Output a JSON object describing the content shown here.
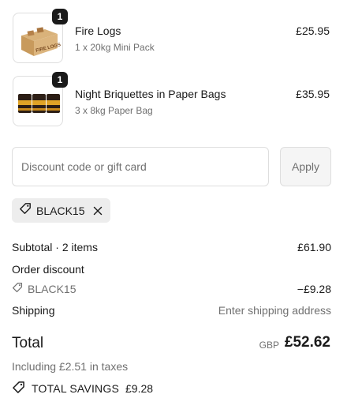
{
  "cart": {
    "items": [
      {
        "quantity": "1",
        "title": "Fire Logs",
        "variant": "1 x 20kg Mini Pack",
        "price": "£25.95",
        "image_label": "FIRE LOGS"
      },
      {
        "quantity": "1",
        "title": "Night Briquettes in Paper Bags",
        "variant": "3 x 8kg Paper Bag",
        "price": "£35.95"
      }
    ]
  },
  "discount": {
    "placeholder": "Discount code or gift card",
    "apply_label": "Apply",
    "applied_code": "BLACK15"
  },
  "summary": {
    "subtotal_label": "Subtotal · 2 items",
    "subtotal_value": "£61.90",
    "order_discount_label": "Order discount",
    "discount_code": "BLACK15",
    "discount_value": "−£9.28",
    "shipping_label": "Shipping",
    "shipping_value": "Enter shipping address",
    "total_label": "Total",
    "currency": "GBP",
    "total_value": "£52.62",
    "taxes_note": "Including £2.51 in taxes",
    "savings_label": "TOTAL SAVINGS",
    "savings_value": "£9.28"
  },
  "icons": {
    "tag": "tag-icon",
    "close": "close-icon"
  },
  "colors": {
    "text": "#1a1a1a",
    "muted": "#707070",
    "border": "#dedede",
    "chip_bg": "#ededed",
    "badge_bg": "#1a1a1a"
  }
}
